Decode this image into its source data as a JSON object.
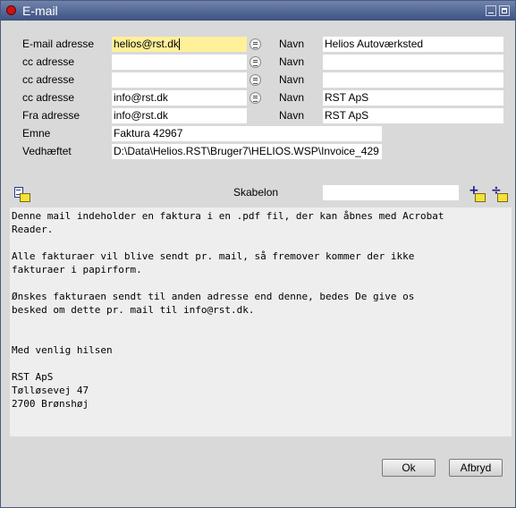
{
  "window": {
    "title": "E-mail"
  },
  "fields": {
    "email_label": "E-mail adresse",
    "email_value": "helios@rst.dk",
    "email_name_label": "Navn",
    "email_name_value": "Helios Autoværksted",
    "cc1_label": "cc adresse",
    "cc1_value": "",
    "cc1_name_label": "Navn",
    "cc1_name_value": "",
    "cc2_label": "cc adresse",
    "cc2_value": "",
    "cc2_name_label": "Navn",
    "cc2_name_value": "",
    "cc3_label": "cc adresse",
    "cc3_value": "info@rst.dk",
    "cc3_name_label": "Navn",
    "cc3_name_value": "RST ApS",
    "from_label": "Fra adresse",
    "from_value": "info@rst.dk",
    "from_name_label": "Navn",
    "from_name_value": "RST ApS",
    "subject_label": "Emne",
    "subject_value": "Faktura 42967",
    "attachment_label": "Vedhæftet",
    "attachment_value": "D:\\Data\\Helios.RST\\Bruger7\\HELIOS.WSP\\Invoice_429"
  },
  "template": {
    "label": "Skabelon",
    "value": ""
  },
  "message": "Denne mail indeholder en faktura i en .pdf fil, der kan åbnes med Acrobat\nReader.\n\nAlle fakturaer vil blive sendt pr. mail, så fremover kommer der ikke\nfakturaer i papirform.\n\nØnskes fakturaen sendt til anden adresse end denne, bedes De give os\nbesked om dette pr. mail til info@rst.dk.\n\n\nMed venlig hilsen\n\nRST ApS\nTølløsevej 47\n2700 Brønshøj",
  "buttons": {
    "ok": "Ok",
    "cancel": "Afbryd"
  },
  "icons": {
    "open_template": "document-folder-icon",
    "add_template": "add-folder-icon",
    "remove_template": "remove-folder-icon",
    "address_menu": "list-menu-icon"
  },
  "colors": {
    "active_field": "#fff09a",
    "title_bar": "#4a5f8f"
  }
}
